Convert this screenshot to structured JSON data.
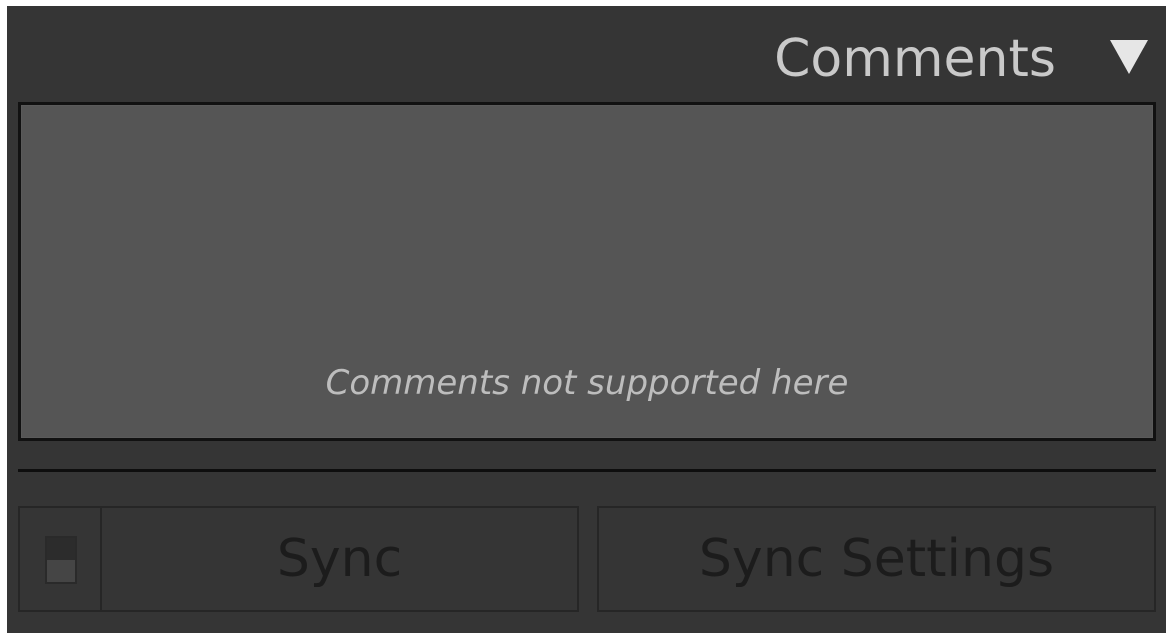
{
  "panel": {
    "title": "Comments",
    "collapse_icon": "triangle-down-icon"
  },
  "comments": {
    "message": "Comments not supported here"
  },
  "bottom_bar": {
    "auto_sync_icon": "toggle-switch-icon",
    "sync_label": "Sync",
    "sync_settings_label": "Sync Settings"
  },
  "colors": {
    "panel_bg": "#353535",
    "box_bg": "#555555",
    "title_text": "#c9c9c9",
    "message_text": "#bdbdbd",
    "disabled_button_text": "#1c1c1c"
  }
}
